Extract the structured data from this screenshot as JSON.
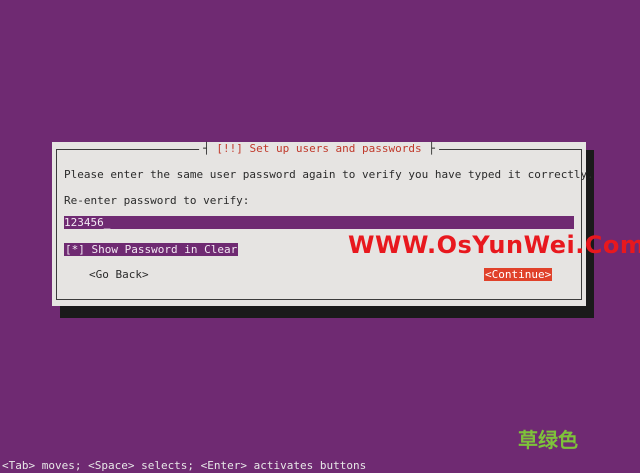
{
  "dialog": {
    "title_prefix": "[!!]",
    "title": "Set up users and passwords",
    "prompt": "Please enter the same user password again to verify you have typed it correctly.",
    "field_label": "Re-enter password to verify:",
    "password_value": "123456",
    "show_password_label": "[*] Show Password in Clear",
    "go_back_label": "<Go Back>",
    "continue_label": "<Continue>"
  },
  "footer": {
    "help_text": "<Tab> moves; <Space> selects; <Enter> activates buttons"
  },
  "watermarks": {
    "site": "WWW.OsYunWei.Com",
    "chinese": "草绿色"
  },
  "colors": {
    "background": "#6f2a72",
    "dialog": "#e6e4e2",
    "accent": "#e0412a",
    "title_text": "#c0392b"
  }
}
